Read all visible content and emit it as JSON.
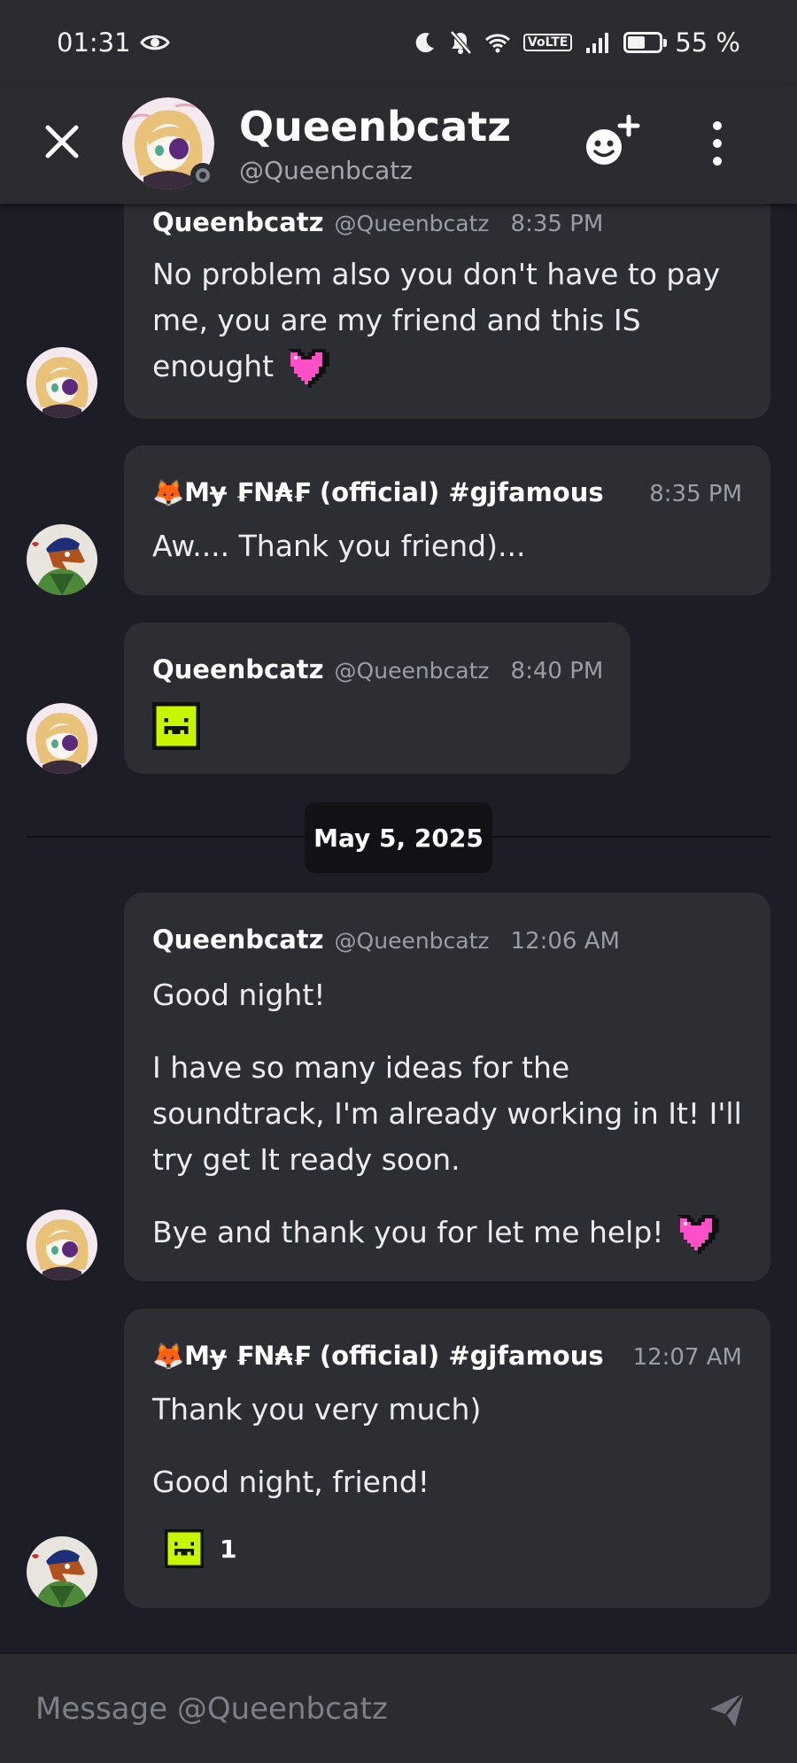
{
  "status_bar": {
    "time": "01:31",
    "volte": "VoLTE",
    "battery": "55 %",
    "battery_level": 0.55
  },
  "header": {
    "name": "Queenbcatz",
    "handle": "@Queenbcatz",
    "presence": "offline"
  },
  "messages": [
    {
      "author": "Queenbcatz",
      "handle": "@Queenbcatz",
      "time": "8:35 PM",
      "text": "No problem also you don't have to pay me, you are my friend and this IS enought",
      "emoji": "pink-heart"
    },
    {
      "author_emoji": "🦊",
      "author": "Mɏ ₣N₳₣ (official) #gjfamous",
      "time": "8:35 PM",
      "text": "Aw.... Thank you friend)..."
    },
    {
      "author": "Queenbcatz",
      "handle": "@Queenbcatz",
      "time": "8:40 PM",
      "emoji": "lime-smile-emoji"
    },
    {
      "author": "Queenbcatz",
      "handle": "@Queenbcatz",
      "time": "12:06 AM",
      "paragraphs": [
        "Good night!",
        "I have so many ideas for the soundtrack, I'm already working in It! I'll try get It ready soon.",
        "Bye and thank you for let me help!"
      ],
      "emoji": "pink-heart"
    },
    {
      "author_emoji": "🦊",
      "author": "Mɏ ₣N₳₣ (official) #gjfamous",
      "time": "12:07 AM",
      "paragraphs": [
        "Thank you very much)",
        "Good night, friend!"
      ],
      "reaction": {
        "emoji": "lime-smile-emoji",
        "count": "1"
      }
    }
  ],
  "date_divider": "May 5, 2025",
  "composer": {
    "placeholder": "Message @Queenbcatz"
  },
  "colors": {
    "background": "#1d1d27",
    "card": "#2d2d34",
    "header": "#2b2b30",
    "heart": "#ff4fc8",
    "lime_emoji": "#c8f500"
  }
}
